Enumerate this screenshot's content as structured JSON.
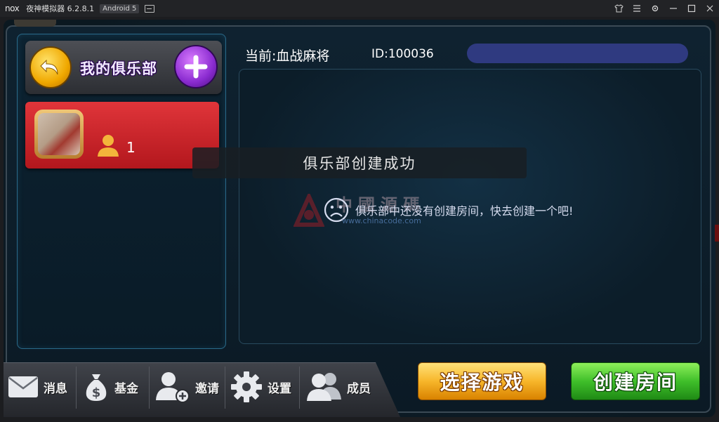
{
  "titlebar": {
    "logo": "nox",
    "app_title": "夜神模拟器 6.2.8.1",
    "android_badge": "Android 5",
    "buttons": [
      "shirt-icon",
      "menu-icon",
      "gear-icon",
      "minimize-icon",
      "maximize-icon",
      "close-icon"
    ]
  },
  "left_panel": {
    "title": "我的俱乐部",
    "clubs": [
      {
        "member_count": "1"
      }
    ]
  },
  "header": {
    "current_game": "当前:血战麻将",
    "club_id": "ID:100036"
  },
  "main": {
    "empty_message": "俱乐部中还没有创建房间，快去创建一个吧!"
  },
  "watermark": {
    "text": "中國源碼",
    "url": "www.chinacode.com"
  },
  "toast": {
    "message": "俱乐部创建成功"
  },
  "bottom_nav": {
    "items": [
      {
        "label": "消息",
        "icon": "mail-icon"
      },
      {
        "label": "基金",
        "icon": "money-bag-icon"
      },
      {
        "label": "邀请",
        "icon": "add-user-icon"
      },
      {
        "label": "设置",
        "icon": "gear-icon"
      },
      {
        "label": "成员",
        "icon": "members-icon"
      }
    ]
  },
  "actions": {
    "select_game": "选择游戏",
    "create_room": "创建房间"
  },
  "colors": {
    "club_item": "#c6232a",
    "select_button": "#f7b62a",
    "create_button": "#3fbf2a",
    "id_bar": "#2f3a80"
  }
}
